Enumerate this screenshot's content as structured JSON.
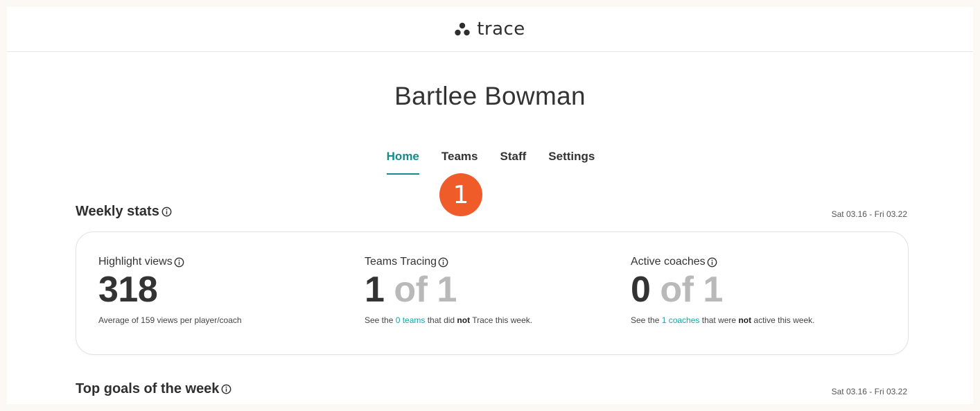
{
  "header": {
    "logo_text": "trace",
    "logo_icon": "three-dots-logo-icon"
  },
  "page": {
    "title": "Bartlee Bowman"
  },
  "tabs": [
    {
      "label": "Home",
      "active": true
    },
    {
      "label": "Teams",
      "active": false
    },
    {
      "label": "Staff",
      "active": false
    },
    {
      "label": "Settings",
      "active": false
    }
  ],
  "step_badge": "1",
  "weekly_stats": {
    "title": "Weekly stats",
    "date_range": "Sat 03.16 - Fri 03.22",
    "highlight_views": {
      "label": "Highlight views",
      "value": "318",
      "caption": "Average of 159 views per player/coach"
    },
    "teams_tracing": {
      "label": "Teams Tracing",
      "value": "1",
      "of_text": " of 1",
      "caption_prefix": "See the ",
      "caption_link": "0 teams",
      "caption_mid": " that did ",
      "caption_bold": "not",
      "caption_suffix": " Trace this week."
    },
    "active_coaches": {
      "label": "Active coaches",
      "value": "0",
      "of_text": " of 1",
      "caption_prefix": "See the ",
      "caption_link": "1 coaches",
      "caption_mid": " that were ",
      "caption_bold": "not",
      "caption_suffix": " active this week."
    }
  },
  "top_goals": {
    "title": "Top goals of the week",
    "date_range": "Sat 03.16 - Fri 03.22"
  },
  "colors": {
    "accent": "#138c8c",
    "link": "#1aa5a5",
    "badge": "#f05b2a",
    "muted": "#b9b9b9",
    "page_bg": "#fcf8f3"
  }
}
